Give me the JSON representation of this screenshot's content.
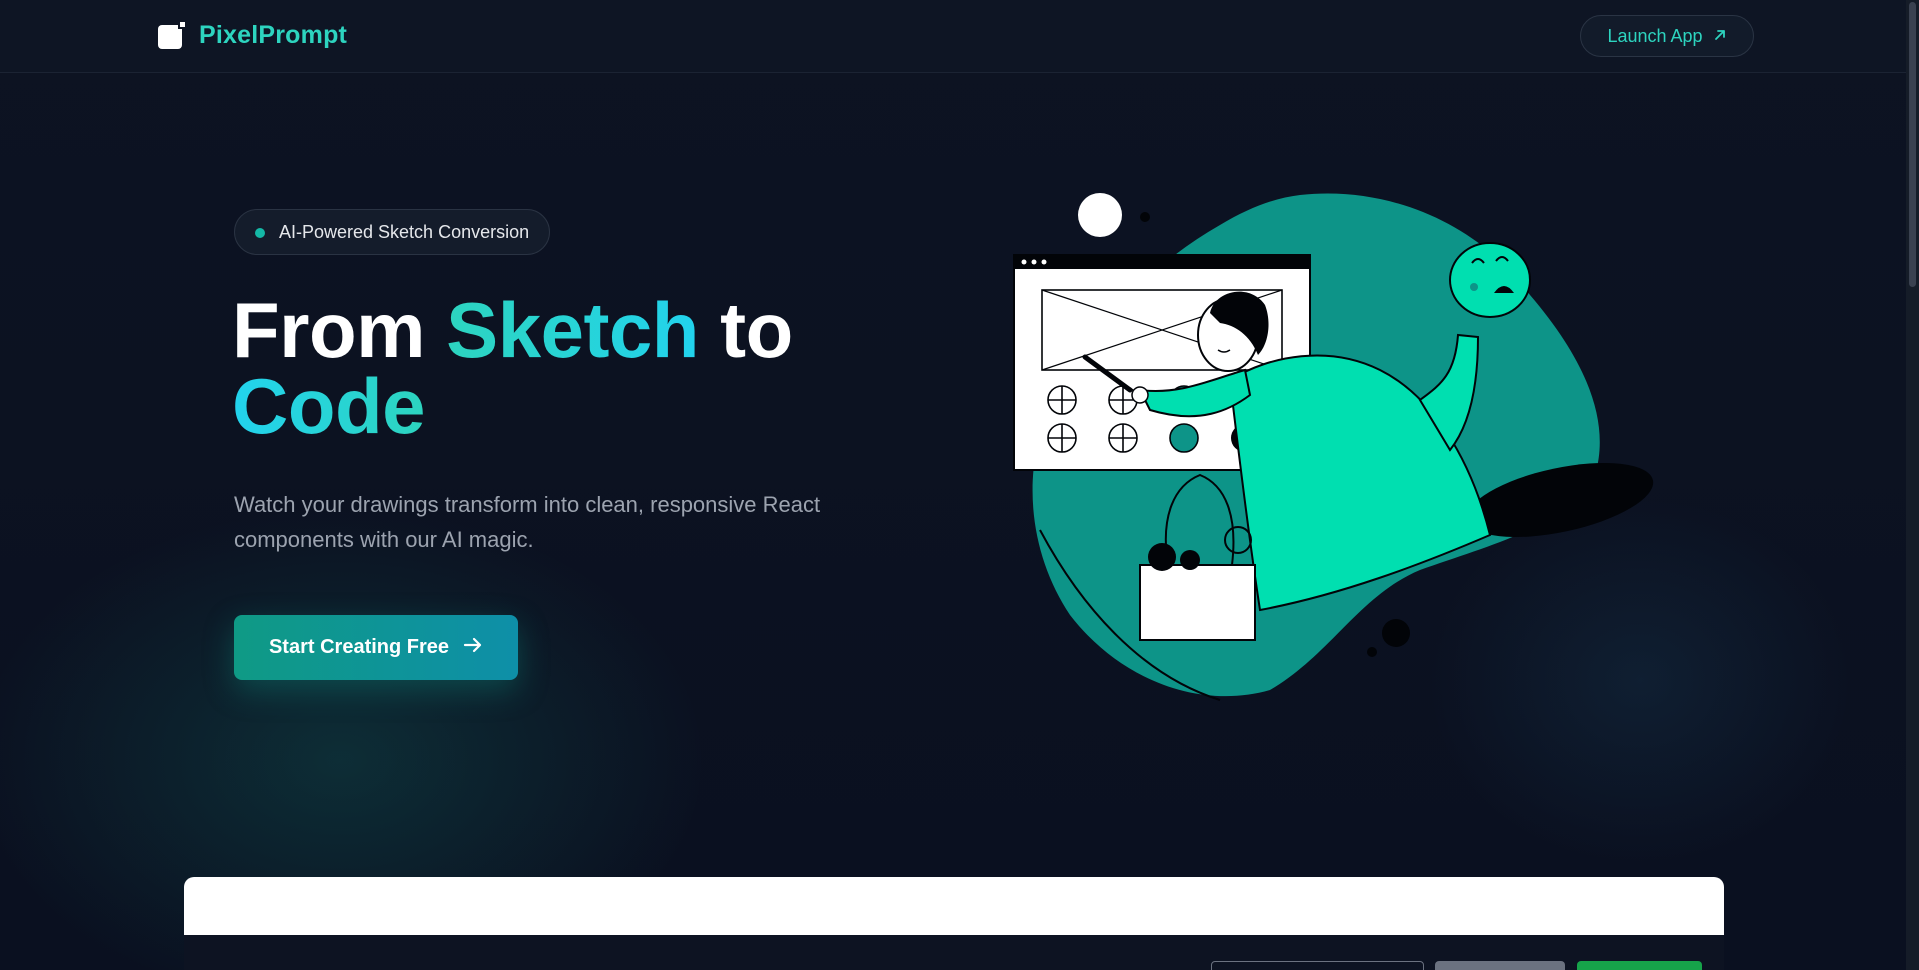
{
  "nav": {
    "brand": "PixelPrompt",
    "launch_label": "Launch App"
  },
  "hero": {
    "badge": "AI-Powered Sketch Conversion",
    "headline_part1": "From ",
    "headline_accent1": "Sketch",
    "headline_part2": " to",
    "headline_accent2": "Code",
    "subtitle": "Watch your drawings transform into clean, responsive React components with our AI magic.",
    "cta_label": "Start Creating Free"
  },
  "colors": {
    "accent": "#2dd4bf",
    "accent_cyan": "#22d3ee",
    "background": "#0b1120",
    "illustration_teal": "#0d9488",
    "illustration_mint": "#00dfb0"
  },
  "icons": {
    "logo": "pixel-square-logo-icon",
    "launch": "arrow-up-right-icon",
    "cta": "arrow-right-icon"
  }
}
